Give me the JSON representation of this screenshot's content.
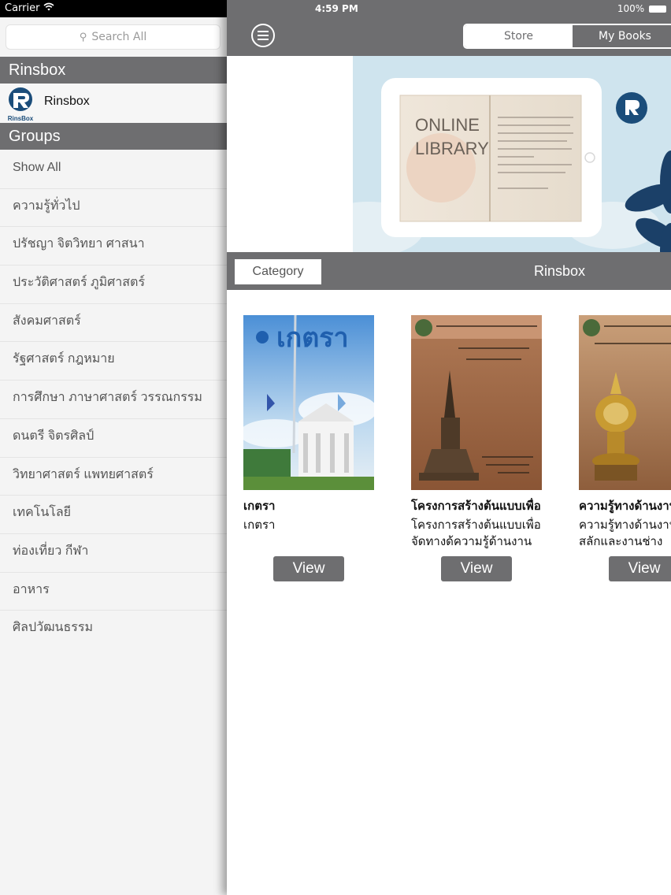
{
  "status_bar": {
    "carrier": "Carrier",
    "time": "4:59 PM",
    "battery": "100%"
  },
  "sidebar": {
    "search_placeholder": "Search All",
    "section_header": "Rinsbox",
    "brand": {
      "name": "Rinsbox",
      "logo_text": "RinsBox"
    },
    "groups_header": "Groups",
    "groups": [
      "Show All",
      "ความรู้ทั่วไป",
      "ปรัชญา จิตวิทยา ศาสนา",
      "ประวัติศาสตร์ ภูมิศาสตร์",
      "สังคมศาสตร์",
      "รัฐศาสตร์ กฎหมาย",
      "การศึกษา ภาษาศาสตร์ วรรณกรรม",
      "ดนตรี จิตรศิลป์",
      "วิทยาศาสตร์ แพทยศาสตร์",
      "เทคโนโลยี",
      "ท่องเที่ยว กีฬา",
      "อาหาร",
      "ศิลปวัฒนธรรม"
    ]
  },
  "nav": {
    "tabs": [
      {
        "label": "Store",
        "selected": true
      },
      {
        "label": "My Books",
        "selected": false
      }
    ]
  },
  "banner": {
    "line1": "ONLINE",
    "line2": "LIBRARY"
  },
  "category_bar": {
    "button_label": "Category",
    "title": "Rinsbox"
  },
  "books": [
    {
      "title": "เกตรา",
      "description": "เกตรา",
      "cover_title": "เกตรา",
      "view_label": "View"
    },
    {
      "title": "โครงการสร้างต้นแบบเพื่อ",
      "description": "โครงการสร้างต้นแบบเพื่อ จัดทางด้ความรู้ด้านงาน",
      "view_label": "View"
    },
    {
      "title": "ความรู้ทางด้านงาน",
      "description": "ความรู้ทางด้านงาน แกะสลักและงานช่าง",
      "view_label": "View"
    }
  ],
  "colors": {
    "nav_gray": "#6e6e70",
    "sidebar_bg": "#f4f4f4",
    "brand_blue": "#1b4d7a"
  }
}
